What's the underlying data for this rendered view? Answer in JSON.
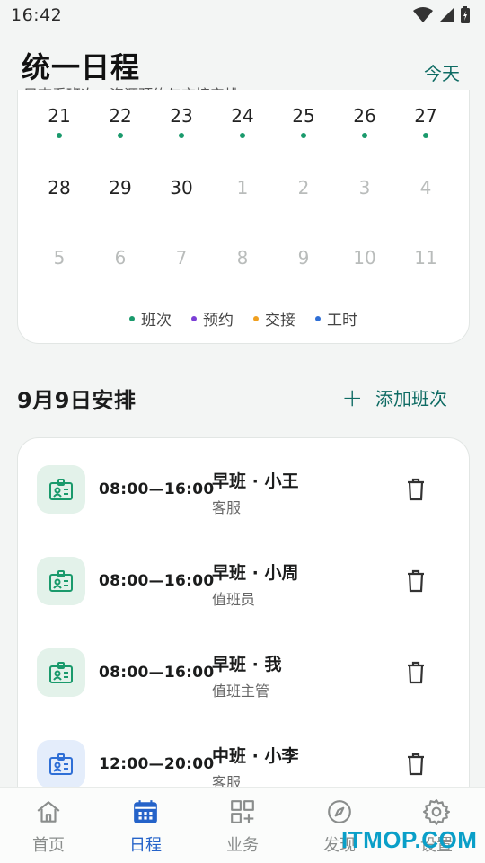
{
  "status": {
    "time": "16:42"
  },
  "header": {
    "title": "统一日程",
    "subtitle": "只查看班次、资源预约与交接安排",
    "today": "今天"
  },
  "calendar": {
    "weeks": [
      [
        {
          "d": "21",
          "dot": true
        },
        {
          "d": "22",
          "dot": true
        },
        {
          "d": "23",
          "dot": true
        },
        {
          "d": "24",
          "dot": true
        },
        {
          "d": "25",
          "dot": true
        },
        {
          "d": "26",
          "dot": true
        },
        {
          "d": "27",
          "dot": true
        }
      ],
      [
        {
          "d": "28",
          "dot": false
        },
        {
          "d": "29",
          "dot": false
        },
        {
          "d": "30",
          "dot": false
        },
        {
          "d": "1",
          "dim": true
        },
        {
          "d": "2",
          "dim": true
        },
        {
          "d": "3",
          "dim": true
        },
        {
          "d": "4",
          "dim": true
        }
      ],
      [
        {
          "d": "5",
          "dim": true
        },
        {
          "d": "6",
          "dim": true
        },
        {
          "d": "7",
          "dim": true
        },
        {
          "d": "8",
          "dim": true
        },
        {
          "d": "9",
          "dim": true
        },
        {
          "d": "10",
          "dim": true
        },
        {
          "d": "11",
          "dim": true
        }
      ]
    ],
    "legend": [
      {
        "label": "班次",
        "color": "#1a9a6c"
      },
      {
        "label": "预约",
        "color": "#7b3fd6"
      },
      {
        "label": "交接",
        "color": "#f0a020"
      },
      {
        "label": "工时",
        "color": "#2f6fd6"
      }
    ],
    "dot_color": "#1a9a6c"
  },
  "schedule": {
    "title": "9月9日安排",
    "add_label": "添加班次",
    "shifts": [
      {
        "time": "08:00—16:00",
        "name": "早班 · 小王",
        "role": "客服",
        "tone": "green"
      },
      {
        "time": "08:00—16:00",
        "name": "早班 · 小周",
        "role": "值班员",
        "tone": "green"
      },
      {
        "time": "08:00—16:00",
        "name": "早班 · 我",
        "role": "值班主管",
        "tone": "green"
      },
      {
        "time": "12:00—20:00",
        "name": "中班 · 小李",
        "role": "客服",
        "tone": "blue"
      }
    ]
  },
  "nav": [
    {
      "label": "首页",
      "icon": "home-icon"
    },
    {
      "label": "日程",
      "icon": "calendar-icon",
      "active": true
    },
    {
      "label": "业务",
      "icon": "apps-add-icon"
    },
    {
      "label": "发现",
      "icon": "compass-icon"
    },
    {
      "label": "设置",
      "icon": "gear-icon"
    }
  ],
  "watermark": "ITMOP.COM"
}
